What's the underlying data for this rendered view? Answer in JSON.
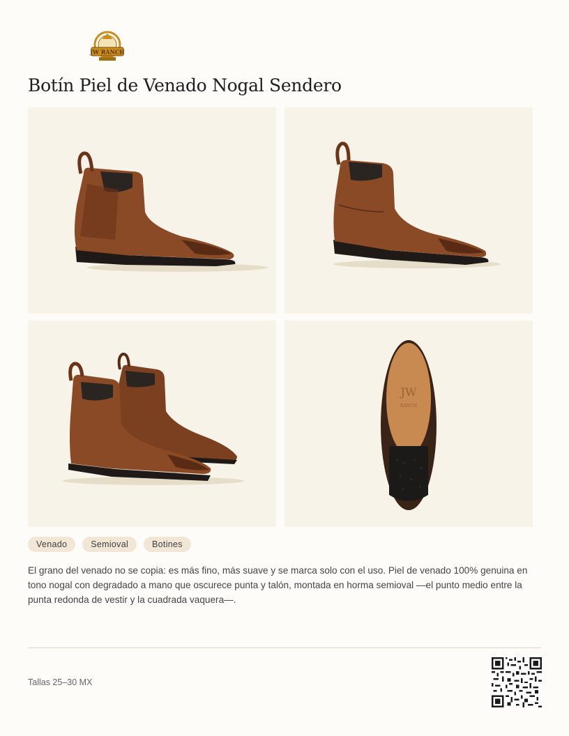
{
  "product": {
    "title": "Botín Piel de Venado Nogal Sendero",
    "tags": [
      "Venado",
      "Semioval",
      "Botines"
    ],
    "description": "El grano del venado no se copia: es más fino, más suave y se marca solo con el uso. Piel de venado 100% genuina en tono nogal con degradado a mano que oscurece punta y talón, montada en horma semioval —el punto medio entre la punta redonda de vestir y la cuadrada vaquera—.",
    "sizes": "Tallas 25–30 MX"
  },
  "brand": {
    "logo_text": "JW RANCH"
  },
  "colors": {
    "leather": "#8a4a26",
    "leather_dark": "#4a2412",
    "elastic": "#2b2521",
    "sole": "#1f1a17",
    "background": "#f7f3e8",
    "tag_bg": "#f2e7d6"
  }
}
